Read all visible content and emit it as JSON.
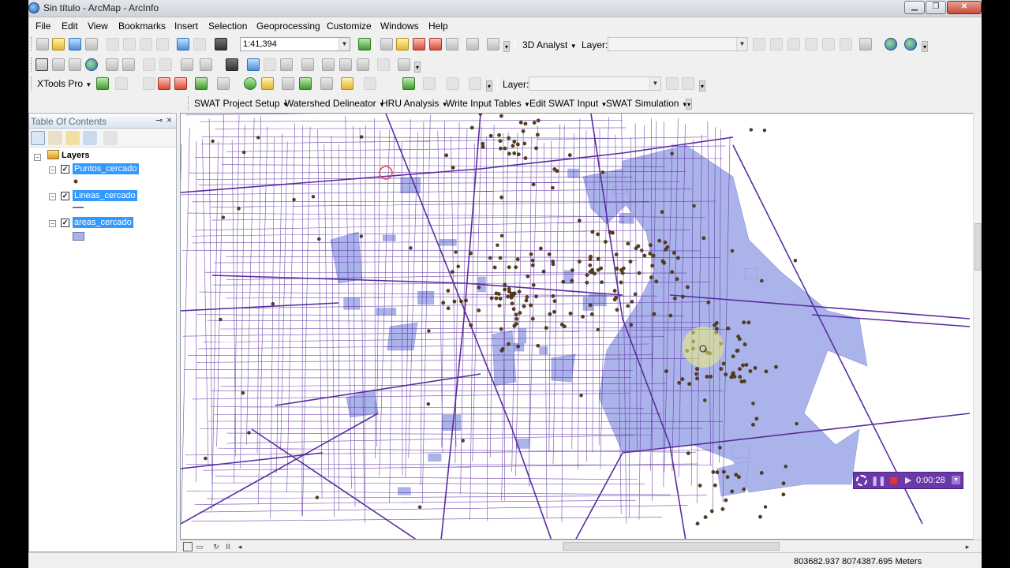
{
  "window": {
    "title": "Sin título - ArcMap - ArcInfo"
  },
  "menu": [
    "File",
    "Edit",
    "View",
    "Bookmarks",
    "Insert",
    "Selection",
    "Geoprocessing",
    "Customize",
    "Windows",
    "Help"
  ],
  "toolbar1": {
    "scale": "1:41,394",
    "analyst_label": "3D Analyst",
    "layer_label": "Layer:",
    "layer_value": ""
  },
  "toolbar3": {
    "xtools_label": "XTools Pro",
    "layer_label": "Layer:",
    "layer_value": ""
  },
  "swat_toolbar": [
    "SWAT Project Setup",
    "Watershed Delineator",
    "HRU Analysis",
    "Write Input Tables",
    "Edit SWAT Input",
    "SWAT Simulation"
  ],
  "toc": {
    "title": "Table Of Contents",
    "root_label": "Layers",
    "layers": [
      {
        "name": "Puntos_cercado",
        "checked": true,
        "symbol": "point"
      },
      {
        "name": "Lineas_cercado",
        "checked": true,
        "symbol": "line"
      },
      {
        "name": "areas_cercado",
        "checked": true,
        "symbol": "polygon"
      }
    ]
  },
  "map": {
    "line_color": "#5b2ca0",
    "area_color": "#aab4ea",
    "point_color": "#5a3d1e"
  },
  "recorder": {
    "time": "0:00:28"
  },
  "status": {
    "coordinates": "803682.937  8074387.695 Meters"
  }
}
